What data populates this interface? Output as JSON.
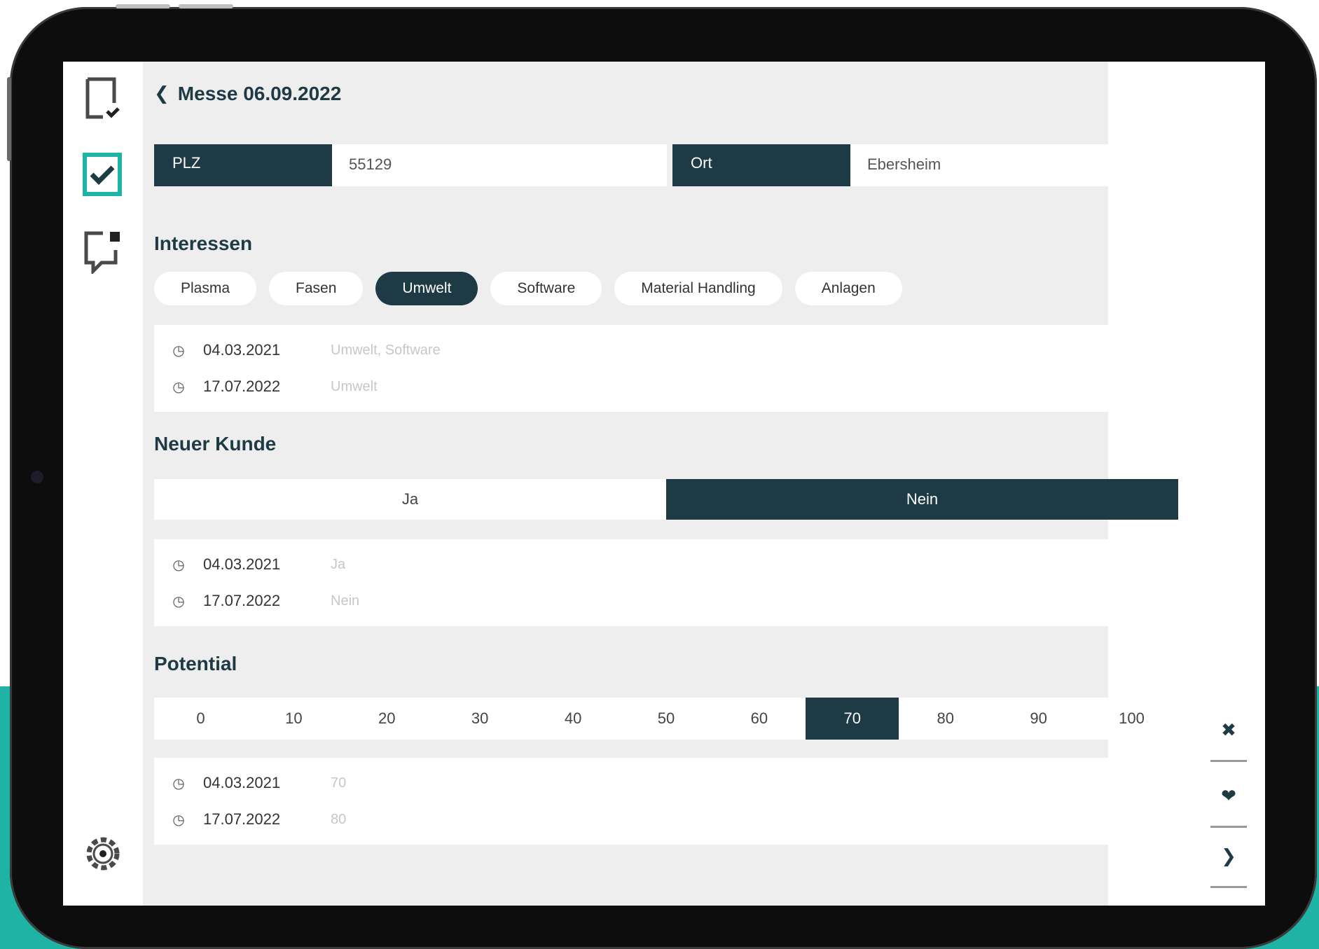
{
  "header": {
    "back_icon": "chevron-left-icon",
    "title": "Messe 06.09.2022"
  },
  "fields": {
    "plz": {
      "label": "PLZ",
      "value": "55129"
    },
    "ort": {
      "label": "Ort",
      "value": "Ebersheim"
    }
  },
  "interessen": {
    "title": "Interessen",
    "chips": [
      {
        "label": "Plasma",
        "active": false
      },
      {
        "label": "Fasen",
        "active": false
      },
      {
        "label": "Umwelt",
        "active": true
      },
      {
        "label": "Software",
        "active": false
      },
      {
        "label": "Material Handling",
        "active": false
      },
      {
        "label": "Anlagen",
        "active": false
      }
    ],
    "history": [
      {
        "date": "04.03.2021",
        "value": "Umwelt, Software"
      },
      {
        "date": "17.07.2022",
        "value": "Umwelt"
      }
    ]
  },
  "neuer_kunde": {
    "title": "Neuer Kunde",
    "options": [
      {
        "label": "Ja",
        "active": false
      },
      {
        "label": "Nein",
        "active": true
      }
    ],
    "history": [
      {
        "date": "04.03.2021",
        "value": "Ja"
      },
      {
        "date": "17.07.2022",
        "value": "Nein"
      }
    ]
  },
  "potential": {
    "title": "Potential",
    "scale": [
      "0",
      "10",
      "20",
      "30",
      "40",
      "50",
      "60",
      "70",
      "80",
      "90",
      "100"
    ],
    "selected": "70",
    "history": [
      {
        "date": "04.03.2021",
        "value": "70"
      },
      {
        "date": "17.07.2022",
        "value": "80"
      }
    ]
  },
  "sidebar_icons": [
    "document-check-icon",
    "checkbox-icon",
    "chat-note-icon",
    "settings-gear-icon"
  ],
  "right_actions": [
    "close-icon",
    "heart-icon",
    "chevron-right-icon"
  ],
  "colors": {
    "primary": "#1e3a45",
    "accent": "#1fb3a6",
    "background": "#eeeeee"
  }
}
